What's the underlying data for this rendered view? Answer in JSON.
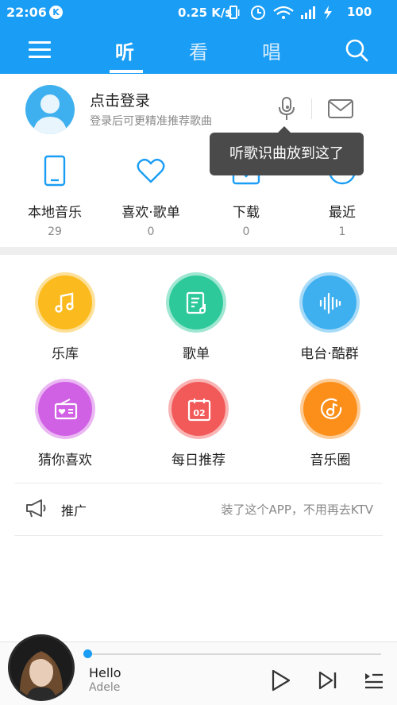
{
  "status_bar": {
    "time": "22:06",
    "app_badge": "K",
    "network_speed": "0.25 K/s",
    "battery": "100"
  },
  "header": {
    "tabs": [
      {
        "label": "听",
        "active": true
      },
      {
        "label": "看",
        "active": false
      },
      {
        "label": "唱",
        "active": false
      }
    ],
    "accent_color": "#1a9df5"
  },
  "login": {
    "title": "点击登录",
    "subtitle": "登录后可更精准推荐歌曲",
    "tooltip": "听歌识曲放到这了"
  },
  "quick_row": [
    {
      "label": "本地音乐",
      "count": "29",
      "icon": "phone-icon"
    },
    {
      "label": "喜欢·歌单",
      "count": "0",
      "icon": "heart-icon"
    },
    {
      "label": "下载",
      "count": "0",
      "icon": "download-icon"
    },
    {
      "label": "最近",
      "count": "1",
      "icon": "clock-icon"
    }
  ],
  "grid": [
    {
      "label": "乐库",
      "color": "#fbba1d",
      "icon": "music-note-icon"
    },
    {
      "label": "歌单",
      "color": "#2ec99b",
      "icon": "playlist-icon"
    },
    {
      "label": "电台·酷群",
      "color": "#3fb0ef",
      "icon": "soundwave-icon"
    },
    {
      "label": "猜你喜欢",
      "color": "#d060e4",
      "icon": "radio-heart-icon"
    },
    {
      "label": "每日推荐",
      "color": "#f25a5a",
      "icon": "calendar-icon"
    },
    {
      "label": "音乐圈",
      "color": "#fb8f1a",
      "icon": "music-disc-icon"
    }
  ],
  "calendar_day": "02",
  "promo": {
    "label": "推广",
    "text": "装了这个APP，不用再去KTV"
  },
  "player": {
    "song_title": "Hello",
    "artist": "Adele",
    "progress": 0.0
  }
}
